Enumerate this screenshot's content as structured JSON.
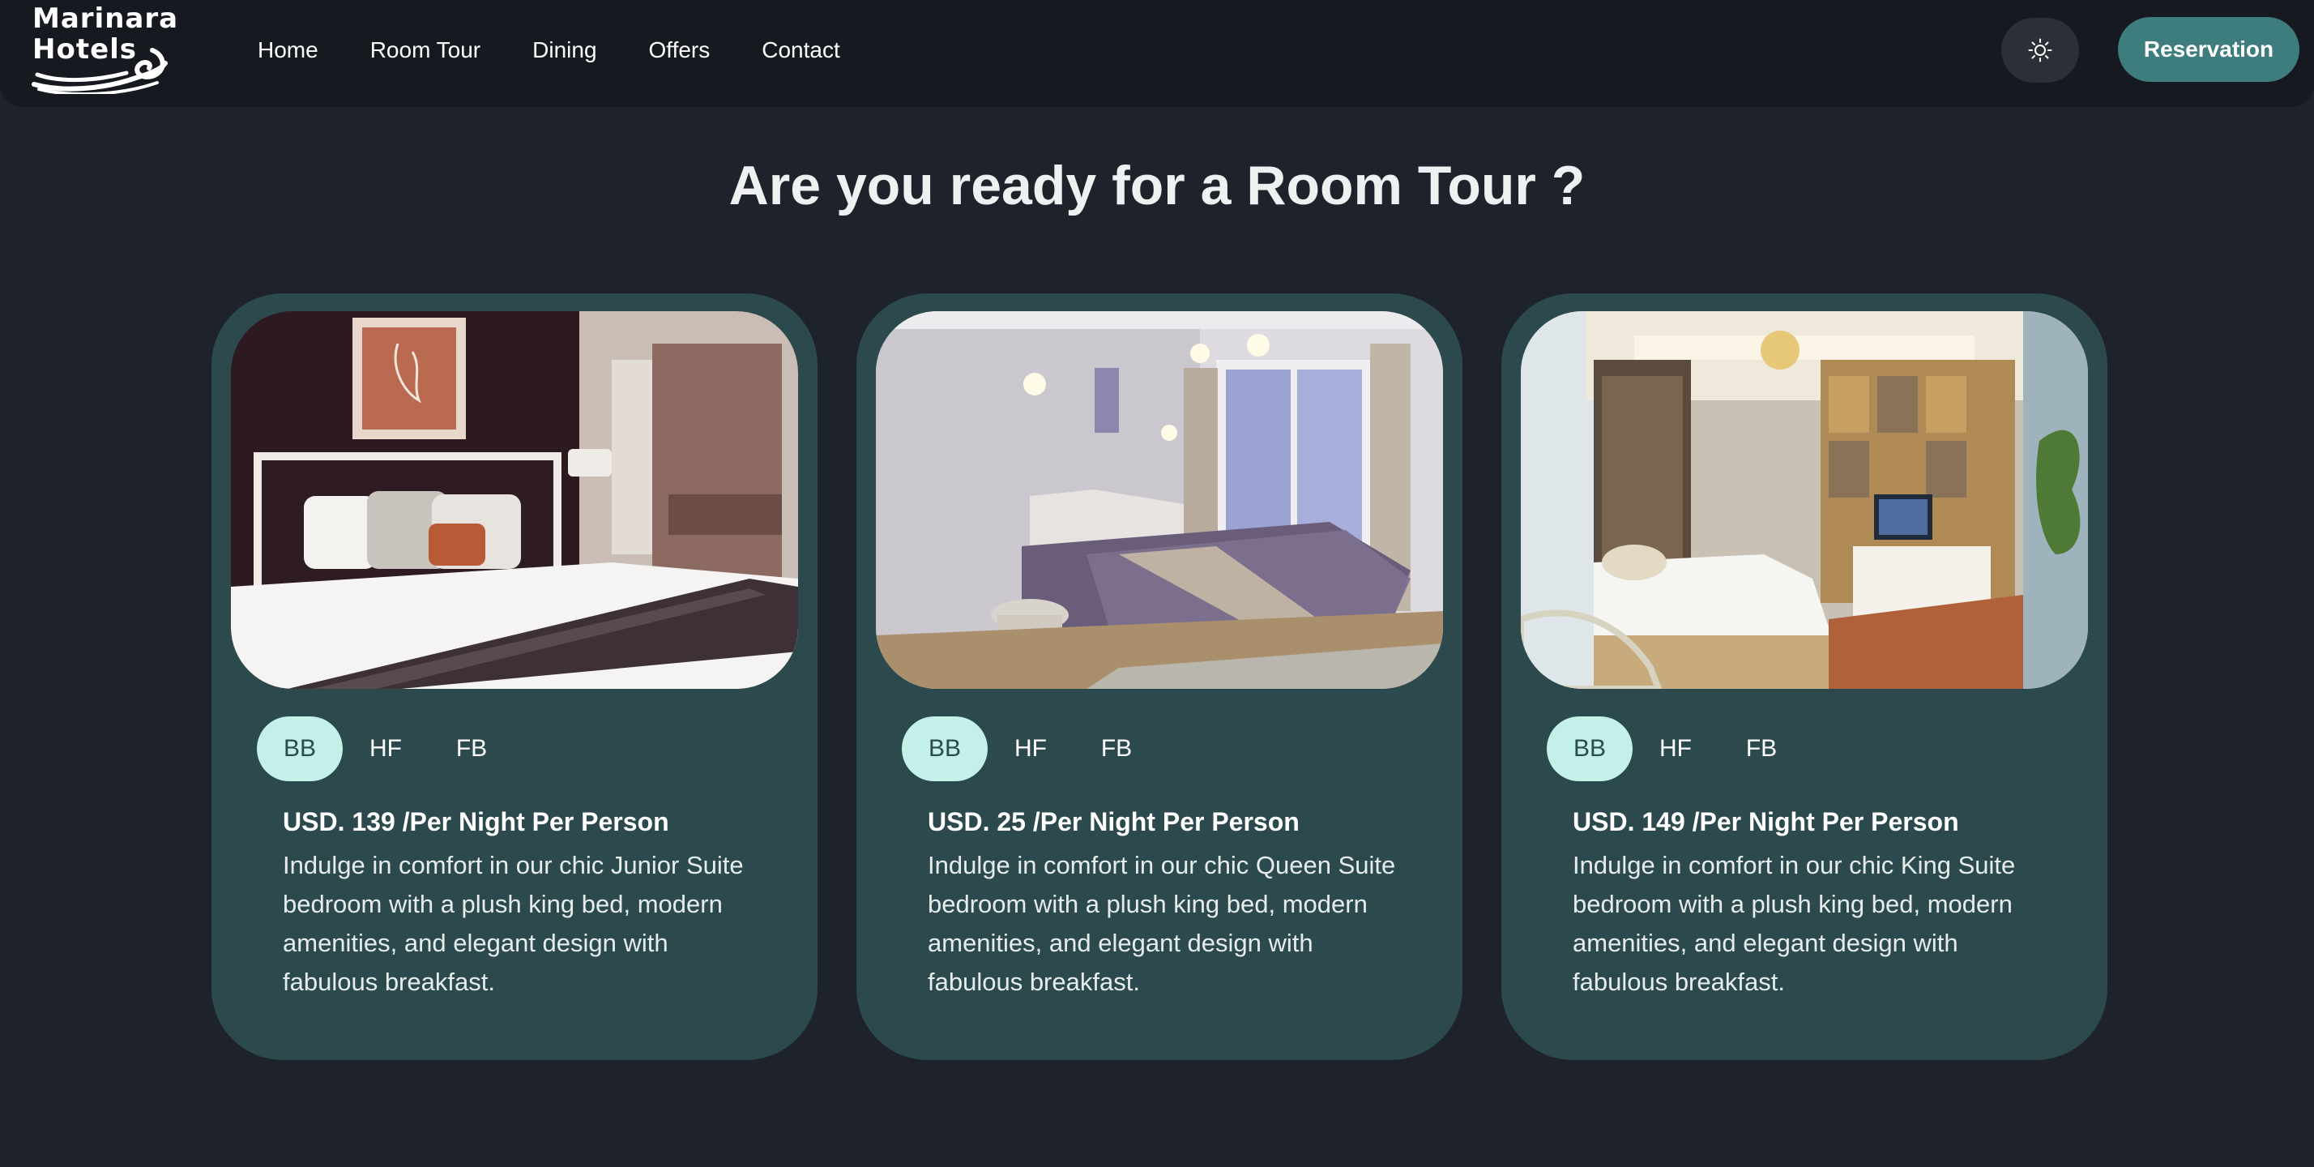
{
  "brand": {
    "line1": "Marinara",
    "line2": "Hotels"
  },
  "nav": {
    "links": [
      "Home",
      "Room Tour",
      "Dining",
      "Offers",
      "Contact"
    ],
    "theme_toggle_icon": "sun-icon",
    "reservation_label": "Reservation"
  },
  "colors": {
    "background": "#1e222b",
    "navbar": "#161a20",
    "card": "#2c4a4d",
    "accent": "#3e7d7e",
    "active_tab": "#c3f1ea"
  },
  "main": {
    "title": "Are you ready for a Room Tour ?",
    "rooms": [
      {
        "plans": [
          "BB",
          "HF",
          "FB"
        ],
        "active_plan": "BB",
        "price": "USD. 139 /Per Night Per Person",
        "description": "Indulge in comfort in our chic Junior Suite bedroom with a plush king bed, modern amenities, and elegant design with fabulous breakfast."
      },
      {
        "plans": [
          "BB",
          "HF",
          "FB"
        ],
        "active_plan": "BB",
        "price": "USD. 25 /Per Night Per Person",
        "description": "Indulge in comfort in our chic Queen Suite bedroom with a plush king bed, modern amenities, and elegant design with fabulous breakfast."
      },
      {
        "plans": [
          "BB",
          "HF",
          "FB"
        ],
        "active_plan": "BB",
        "price": "USD. 149 /Per Night Per Person",
        "description": "Indulge in comfort in our chic King Suite bedroom with a plush king bed, modern amenities, and elegant design with fabulous breakfast."
      }
    ]
  }
}
